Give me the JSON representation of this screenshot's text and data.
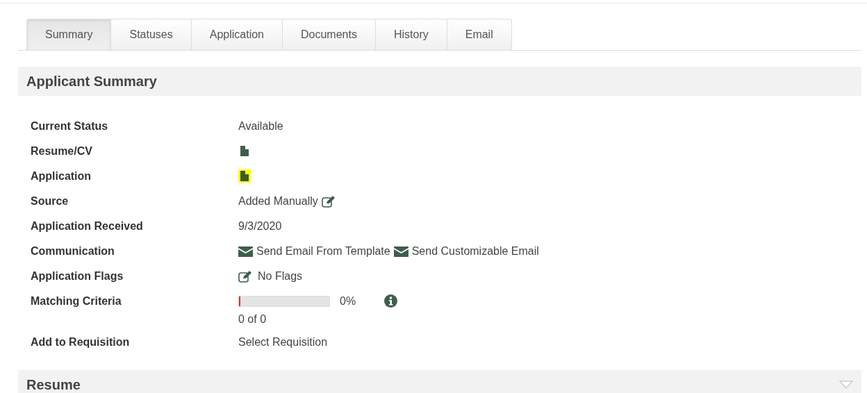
{
  "tabs": [
    {
      "label": "Summary",
      "selected": true
    },
    {
      "label": "Statuses",
      "selected": false
    },
    {
      "label": "Application",
      "selected": false
    },
    {
      "label": "Documents",
      "selected": false
    },
    {
      "label": "History",
      "selected": false
    },
    {
      "label": "Email",
      "selected": false
    }
  ],
  "applicant_summary": {
    "title": "Applicant Summary",
    "rows": [
      {
        "kind": "text",
        "label": "Current Status",
        "value": "Available"
      },
      {
        "kind": "document",
        "label": "Resume/CV",
        "highlighted": false
      },
      {
        "kind": "document",
        "label": "Application",
        "highlighted": true
      },
      {
        "kind": "editable",
        "label": "Source",
        "value": "Added Manually"
      },
      {
        "kind": "text",
        "label": "Application Received",
        "value": "9/3/2020"
      },
      {
        "kind": "emails",
        "label": "Communication",
        "links": [
          "Send Email From Template",
          "Send Customizable Email"
        ]
      },
      {
        "kind": "flags",
        "label": "Application Flags",
        "value": "No Flags"
      },
      {
        "kind": "meter",
        "label": "Matching Criteria",
        "level": 0,
        "reading": "0%",
        "count": "0 of 0"
      },
      {
        "kind": "link",
        "label": "Add to Requisition",
        "value": "Select Requisition"
      }
    ]
  },
  "resume": {
    "title": "Resume"
  }
}
